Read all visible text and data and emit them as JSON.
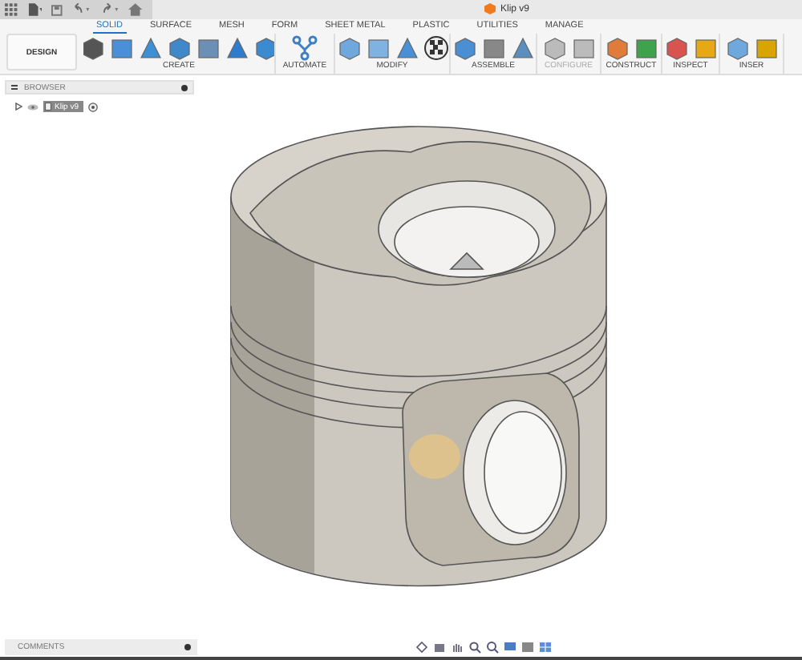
{
  "window": {
    "title": "Klip v9"
  },
  "workspace": {
    "label": "DESIGN"
  },
  "tabs": [
    {
      "label": "SOLID",
      "selected": true
    },
    {
      "label": "SURFACE",
      "selected": false
    },
    {
      "label": "MESH",
      "selected": false
    },
    {
      "label": "FORM",
      "selected": false
    },
    {
      "label": "SHEET METAL",
      "selected": false
    },
    {
      "label": "PLASTIC",
      "selected": false
    },
    {
      "label": "UTILITIES",
      "selected": false
    },
    {
      "label": "MANAGE",
      "selected": false
    }
  ],
  "groups": [
    {
      "label": "CREATE",
      "disabled": false
    },
    {
      "label": "AUTOMATE",
      "disabled": false
    },
    {
      "label": "MODIFY",
      "disabled": false
    },
    {
      "label": "ASSEMBLE",
      "disabled": false
    },
    {
      "label": "CONFIGURE",
      "disabled": true
    },
    {
      "label": "CONSTRUCT",
      "disabled": false
    },
    {
      "label": "INSPECT",
      "disabled": false
    },
    {
      "label": "INSER",
      "disabled": false
    }
  ],
  "browser": {
    "title": "BROWSER",
    "items": [
      {
        "label": "Klip v9",
        "expanded": false
      }
    ]
  },
  "comments": {
    "title": "COMMENTS"
  }
}
